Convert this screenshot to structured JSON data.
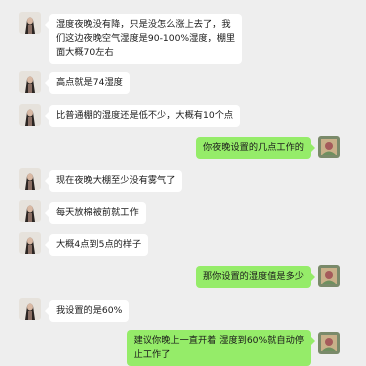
{
  "messages": [
    {
      "side": "in",
      "lines": [
        "湿度夜晚没有降，只是没怎么涨上去了，我",
        "们这边夜晚空气湿度是90-100%湿度，棚里",
        "面大概70左右"
      ]
    },
    {
      "side": "in",
      "lines": [
        "高点就是74湿度"
      ]
    },
    {
      "side": "in",
      "lines": [
        "比普通棚的湿度还是低不少，大概有10个点"
      ]
    },
    {
      "side": "out",
      "lines": [
        "你夜晚设置的几点工作的"
      ]
    },
    {
      "side": "in",
      "lines": [
        "现在夜晚大棚至少没有雾气了"
      ]
    },
    {
      "side": "in",
      "lines": [
        "每天放棉被前就工作"
      ]
    },
    {
      "side": "in",
      "lines": [
        "大概4点到5点的样子"
      ]
    },
    {
      "side": "out",
      "lines": [
        "那你设置的湿度值是多少"
      ]
    },
    {
      "side": "in",
      "lines": [
        "我设置的是60%"
      ]
    },
    {
      "side": "out",
      "lines": [
        "建议你晚上一直开着 湿度到60%就自动停",
        "止工作了"
      ]
    }
  ]
}
